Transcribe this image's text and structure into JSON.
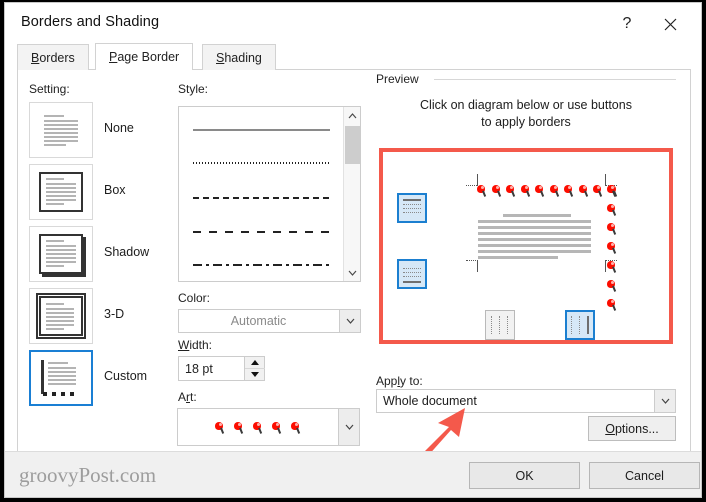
{
  "window": {
    "title": "Borders and Shading",
    "help_label": "?",
    "close_label": "close-icon"
  },
  "tabs": [
    {
      "label": "Borders",
      "accel": "B",
      "active": false
    },
    {
      "label": "Page Border",
      "accel": "P",
      "active": true
    },
    {
      "label": "Shading",
      "accel": "S",
      "active": false
    }
  ],
  "setting": {
    "label": "Setting:",
    "selected": "Custom",
    "options": [
      {
        "label": "None",
        "accel": "N"
      },
      {
        "label": "Box",
        "accel": "x"
      },
      {
        "label": "Shadow",
        "accel": "a"
      },
      {
        "label": "3-D",
        "accel": "D"
      },
      {
        "label": "Custom",
        "accel": "u"
      }
    ]
  },
  "style": {
    "label": "Style:",
    "options": [
      "solid",
      "dotted",
      "dashed-fine",
      "dashed-wide",
      "dash-dot"
    ],
    "scroll_up": "chevron-up-icon",
    "scroll_down": "chevron-down-icon"
  },
  "color": {
    "label": "Color:",
    "value": "Automatic"
  },
  "width": {
    "label": "Width:",
    "accel": "W",
    "value": "18 pt",
    "up": "spinner-up-icon",
    "down": "spinner-down-icon"
  },
  "art": {
    "label": "Art:",
    "accel": "r",
    "value": "red-pushpin-border",
    "item_count": 5
  },
  "preview": {
    "title": "Preview",
    "hint_line1": "Click on diagram below or use buttons",
    "hint_line2": "to apply borders",
    "buttons": [
      {
        "name": "top-border-toggle",
        "active": true
      },
      {
        "name": "bottom-border-toggle",
        "active": true
      },
      {
        "name": "left-border-toggle",
        "active": false
      },
      {
        "name": "right-border-toggle",
        "active": true
      }
    ],
    "highlight_color": "#f4594b"
  },
  "apply_to": {
    "label": "Apply to:",
    "accel": "l",
    "value": "Whole document"
  },
  "options_button": {
    "label": "Options...",
    "accel": "O"
  },
  "footer": {
    "watermark": "groovyPost.com",
    "ok_label": "OK",
    "cancel_label": "Cancel"
  },
  "annotation": {
    "arrow_color": "#f4594b",
    "points_at": "apply-to-dropdown"
  }
}
